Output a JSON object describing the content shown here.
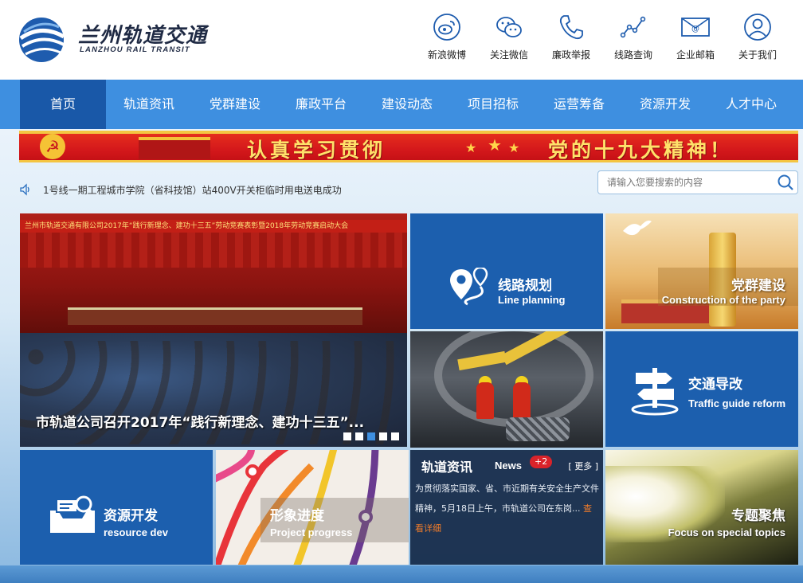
{
  "header": {
    "logo_cn": "兰州轨道交通",
    "logo_en": "LANZHOU RAIL TRANSIT",
    "top_links": [
      {
        "label": "新浪微博",
        "icon": "weibo-icon"
      },
      {
        "label": "关注微信",
        "icon": "wechat-icon"
      },
      {
        "label": "廉政举报",
        "icon": "phone-icon"
      },
      {
        "label": "线路查询",
        "icon": "route-icon"
      },
      {
        "label": "企业邮箱",
        "icon": "mail-icon"
      },
      {
        "label": "关于我们",
        "icon": "user-icon"
      }
    ]
  },
  "nav": {
    "items": [
      "首页",
      "轨道资讯",
      "党群建设",
      "廉政平台",
      "建设动态",
      "项目招标",
      "运营筹备",
      "资源开发",
      "人才中心"
    ],
    "active_index": 0
  },
  "banner": {
    "text_left": "认真学习贯彻",
    "text_right": "党的十九大精神！"
  },
  "notice": {
    "text": "1号线一期工程城市学院（省科技馆）站400V开关柜临时用电送电成功"
  },
  "search": {
    "placeholder": "请输入您要搜索的内容"
  },
  "slideshow": {
    "banner_text": "兰州市轨道交通有限公司2017年“践行新理念、建功十三五”劳动竞赛表彰暨2018年劳动竞赛启动大会",
    "caption": "市轨道公司召开2017年“践行新理念、建功十三五”...",
    "dot_count": 5,
    "active_dot": 3
  },
  "tiles": {
    "line_planning": {
      "cn": "线路规划",
      "en": "Line planning"
    },
    "party": {
      "cn": "党群建设",
      "en": "Construction of the party"
    },
    "traffic": {
      "cn": "交通导改",
      "en": "Traffic guide reform"
    },
    "resource": {
      "cn": "资源开发",
      "en": "resource dev"
    },
    "progress": {
      "cn": "形象进度",
      "en": "Project progress"
    },
    "special": {
      "cn": "专题聚焦",
      "en": "Focus on special topics"
    }
  },
  "news": {
    "title": "轨道资讯",
    "en": "News",
    "badge": "+2",
    "more": "[ 更多 ]",
    "body": "为贯彻落实国家、省、市近期有关安全生产文件精神，5月18日上午，市轨道公司在东岗...",
    "link": "查看详细"
  },
  "colors": {
    "nav": "#3e8fe0",
    "nav_active": "#1958a8",
    "tile_blue": "#1c5fae",
    "banner_red": "#d4181b",
    "banner_text": "#ffe16a",
    "news_link": "#f07c2a"
  }
}
